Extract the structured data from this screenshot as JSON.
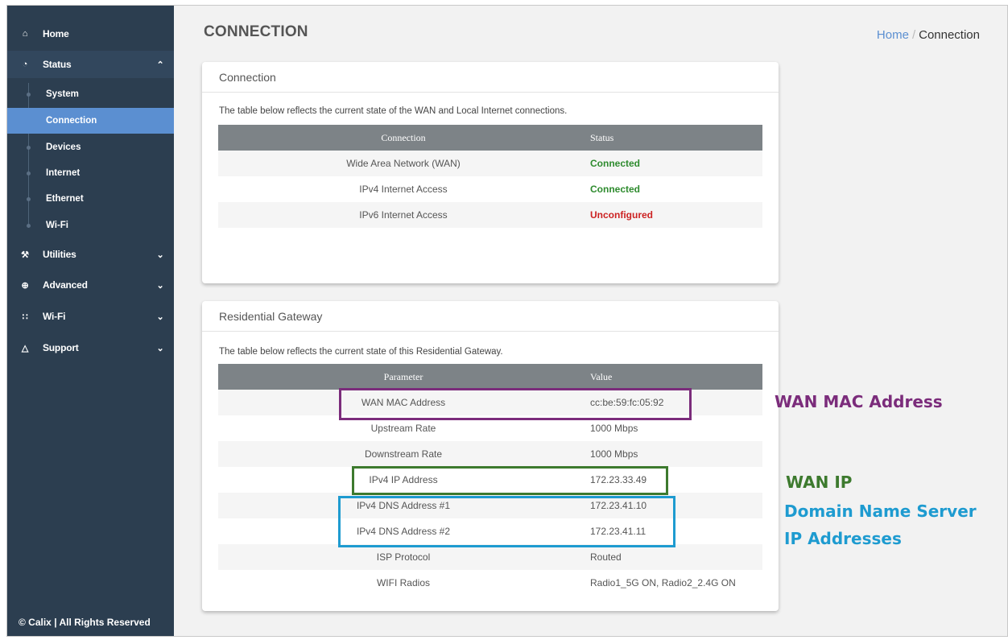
{
  "sidebar": {
    "items": [
      {
        "label": "Home",
        "icon": "home-icon"
      },
      {
        "label": "Status",
        "icon": "dashboard-icon"
      },
      {
        "label": "Utilities",
        "icon": "wrench-icon"
      },
      {
        "label": "Advanced",
        "icon": "globe-icon"
      },
      {
        "label": "Wi-Fi",
        "icon": "wifi-icon"
      },
      {
        "label": "Support",
        "icon": "cloud-icon"
      }
    ],
    "status_sub": [
      "System",
      "Connection",
      "Devices",
      "Internet",
      "Ethernet",
      "Wi-Fi"
    ],
    "footer": "© Calix | All Rights Reserved"
  },
  "header": {
    "title": "CONNECTION",
    "breadcrumb_home": "Home",
    "breadcrumb_sep": "/",
    "breadcrumb_current": "Connection"
  },
  "connection_card": {
    "title": "Connection",
    "description": "The table below reflects the current state of the WAN and Local Internet connections.",
    "headers": [
      "Connection",
      "Status"
    ],
    "rows": [
      {
        "name": "Wide Area Network (WAN)",
        "status": "Connected"
      },
      {
        "name": "IPv4 Internet Access",
        "status": "Connected"
      },
      {
        "name": "IPv6 Internet Access",
        "status": "Unconfigured"
      }
    ]
  },
  "gateway_card": {
    "title": "Residential Gateway",
    "description": "The table below reflects the current state of this Residential Gateway.",
    "headers": [
      "Parameter",
      "Value"
    ],
    "rows": [
      {
        "param": "WAN MAC Address",
        "value": "cc:be:59:fc:05:92"
      },
      {
        "param": "Upstream Rate",
        "value": "1000 Mbps"
      },
      {
        "param": "Downstream Rate",
        "value": "1000 Mbps"
      },
      {
        "param": "IPv4 IP Address",
        "value": "172.23.33.49"
      },
      {
        "param": "IPv4 DNS Address #1",
        "value": "172.23.41.10"
      },
      {
        "param": "IPv4 DNS Address #2",
        "value": "172.23.41.11"
      },
      {
        "param": "ISP Protocol",
        "value": "Routed"
      },
      {
        "param": "WIFI Radios",
        "value": "Radio1_5G ON, Radio2_2.4G ON"
      }
    ]
  },
  "annotations": {
    "mac": "WAN MAC Address",
    "wan_ip": "WAN IP",
    "dns_line1": "Domain Name Server",
    "dns_line2": "IP Addresses"
  },
  "colors": {
    "mac": "#7b2c7b",
    "wan_ip": "#3d7a2e",
    "dns": "#1e9bd0"
  }
}
